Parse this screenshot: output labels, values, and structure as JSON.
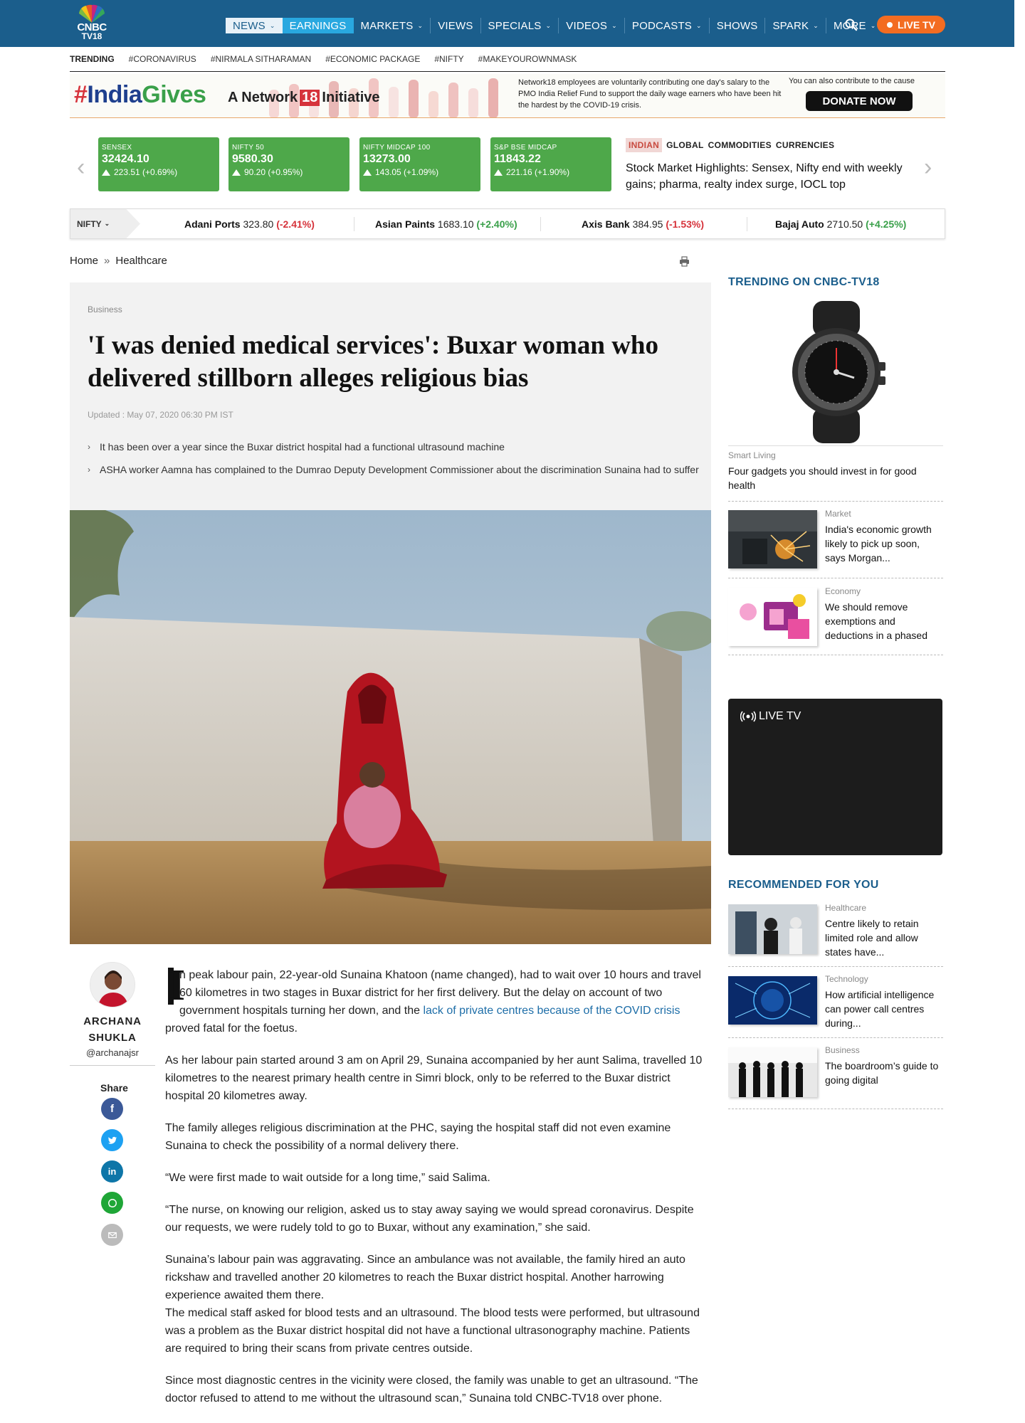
{
  "brand": {
    "line1": "CNBC",
    "line2": "TV18"
  },
  "nav": {
    "items": [
      {
        "label": "NEWS",
        "dropdown": true
      },
      {
        "label": "EARNINGS",
        "dropdown": false
      },
      {
        "label": "MARKETS",
        "dropdown": true
      },
      {
        "label": "VIEWS",
        "dropdown": false
      },
      {
        "label": "SPECIALS",
        "dropdown": true
      },
      {
        "label": "VIDEOS",
        "dropdown": true
      },
      {
        "label": "PODCASTS",
        "dropdown": true
      },
      {
        "label": "SHOWS",
        "dropdown": false
      },
      {
        "label": "SPARK",
        "dropdown": true
      },
      {
        "label": "MORE",
        "dropdown": true
      }
    ],
    "live_tv": "LIVE TV"
  },
  "trending": {
    "label": "TRENDING",
    "tags": [
      "#CORONAVIRUS",
      "#NIRMALA SITHARAMAN",
      "#ECONOMIC PACKAGE",
      "#NIFTY",
      "#MAKEYOUROWNMASK"
    ]
  },
  "banner": {
    "hashtag_prefix": "#",
    "hashtag_a": "India",
    "hashtag_b": "Gives",
    "network_a": "A Network",
    "network_18": "18",
    "network_b": "Initiative",
    "message": "Network18 employees are voluntarily contributing one day's salary to the PMO India Relief Fund to support the daily wage earners who have been hit the hardest by the COVID-19 crisis.",
    "contribute": "You can also contribute to the cause",
    "donate": "DONATE NOW"
  },
  "market_cards": [
    {
      "name": "SENSEX",
      "value": "32424.10",
      "change": "223.51 (+0.69%)"
    },
    {
      "name": "NIFTY 50",
      "value": "9580.30",
      "change": "90.20 (+0.95%)"
    },
    {
      "name": "NIFTY MIDCAP 100",
      "value": "13273.00",
      "change": "143.05 (+1.09%)"
    },
    {
      "name": "S&P BSE MIDCAP",
      "value": "11843.22",
      "change": "221.16 (+1.90%)"
    }
  ],
  "market_tabs": [
    "INDIAN",
    "GLOBAL",
    "COMMODITIES",
    "CURRENCIES"
  ],
  "market_headline": "Stock Market Highlights: Sensex, Nifty end with weekly gains; pharma, realty index surge, IOCL top",
  "ticker": {
    "selector": "NIFTY",
    "items": [
      {
        "name": "Adani Ports",
        "price": "323.80",
        "change": "(-2.41%)",
        "dir": "neg"
      },
      {
        "name": "Asian Paints",
        "price": "1683.10",
        "change": "(+2.40%)",
        "dir": "pos"
      },
      {
        "name": "Axis Bank",
        "price": "384.95",
        "change": "(-1.53%)",
        "dir": "neg"
      },
      {
        "name": "Bajaj Auto",
        "price": "2710.50",
        "change": "(+4.25%)",
        "dir": "pos"
      }
    ]
  },
  "breadcrumb": {
    "home": "Home",
    "sep": "»",
    "section": "Healthcare"
  },
  "article": {
    "category": "Business",
    "title": "'I was denied medical services': Buxar woman who delivered stillborn alleges religious bias",
    "updated": "Updated : May 07, 2020 06:30 PM IST",
    "bullets": [
      "It has been over a year since the Buxar district hospital had a functional ultrasound machine",
      "ASHA worker Aamna has complained to the Dumrao Deputy Development Commissioner about the discrimination Sunaina had to suffer"
    ],
    "author": {
      "name_line1": "ARCHANA",
      "name_line2": "SHUKLA",
      "handle": "@archanajsr"
    },
    "share_label": "Share",
    "p1_dropcap": "I",
    "p1_a": "n peak labour pain, 22-year-old Sunaina Khatoon (name changed), had to wait over 10 hours and travel 60 kilometres in two stages in Buxar district for her first delivery. But the delay on account of two government hospitals turning her down, and the ",
    "p1_link": "lack of private centres because of the COVID crisis",
    "p1_b": " proved fatal for the foetus.",
    "p2": "As her labour pain started around 3 am on April 29, Sunaina accompanied by her aunt Salima, travelled 10 kilometres to the nearest primary health centre in Simri block, only to be referred to the Buxar district hospital 20 kilometres away.",
    "p3": "The family alleges religious discrimination at the PHC, saying the hospital staff did not even examine Sunaina to check the possibility of a normal delivery there.",
    "p4": "“We were first made to wait outside for a long time,” said Salima.",
    "p5": "“The nurse, on knowing our religion, asked us to stay away saying we would spread coronavirus. Despite our requests, we were rudely told to go to Buxar, without any examination,” she said.",
    "p6": "Sunaina’s labour pain was aggravating. Since an ambulance was not available, the family hired an auto rickshaw and travelled another 20 kilometres to reach the Buxar district hospital. Another harrowing experience awaited them there.",
    "p7": "The medical staff asked for blood tests and an ultrasound. The blood tests were performed, but ultrasound was a problem as the Buxar district hospital did not have a functional ultrasonography machine. Patients are required to bring their scans from private centres outside.",
    "p8": "Since most diagnostic centres in the vicinity were closed, the family was unable to get an ultrasound. “The doctor refused to attend to me without the ultrasound scan,” Sunaina told CNBC-TV18 over phone."
  },
  "sidebar": {
    "trending_heading": "TRENDING ON CNBC-TV18",
    "trending": [
      {
        "category": "Smart Living",
        "title": "Four gadgets you should invest in for good health"
      },
      {
        "category": "Market",
        "title": "India's economic growth likely to pick up soon, says Morgan..."
      },
      {
        "category": "Economy",
        "title": "We should remove exemptions and deductions in a phased"
      }
    ],
    "live_tv": "LIVE TV",
    "recommended_heading": "RECOMMENDED FOR YOU",
    "recommended": [
      {
        "category": "Healthcare",
        "title": "Centre likely to retain limited role and allow states have..."
      },
      {
        "category": "Technology",
        "title": "How artificial intelligence can power call centres during..."
      },
      {
        "category": "Business",
        "title": "The boardroom’s guide to going digital"
      }
    ]
  },
  "colors": {
    "header_bg": "#1b5e8c",
    "accent_link": "#1e6ea8",
    "live_orange": "#f36c21",
    "market_green": "#4ea84a",
    "negative_red": "#d6333b",
    "positive_green": "#3aa04a"
  }
}
